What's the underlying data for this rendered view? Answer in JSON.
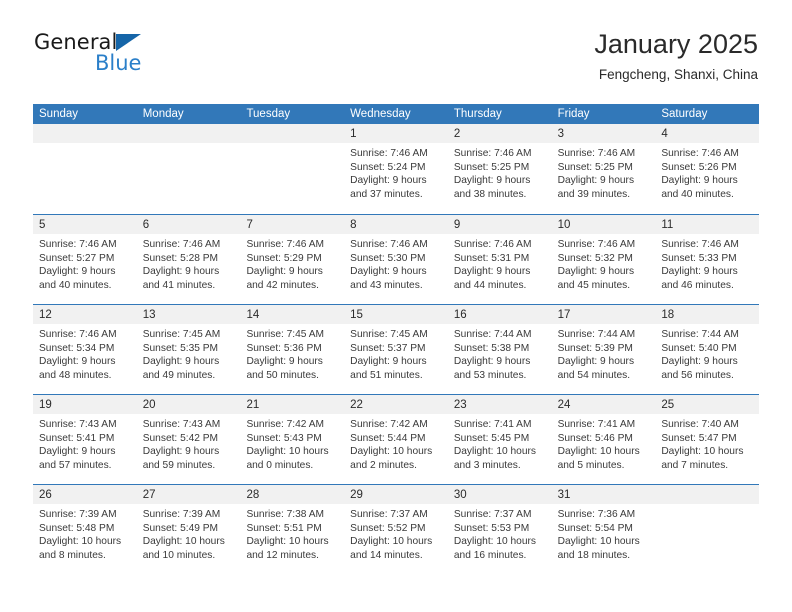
{
  "brand": {
    "name_part1": "General",
    "name_part2": "Blue",
    "triangle_icon": "triangle-icon",
    "accent_color": "#2a7fc9"
  },
  "header": {
    "title": "January 2025",
    "location": "Fengcheng, Shanxi, China"
  },
  "calendar": {
    "header_color": "#3278b9",
    "weekdays": [
      "Sunday",
      "Monday",
      "Tuesday",
      "Wednesday",
      "Thursday",
      "Friday",
      "Saturday"
    ],
    "weeks": [
      [
        {
          "day": "",
          "empty": true
        },
        {
          "day": "",
          "empty": true
        },
        {
          "day": "",
          "empty": true
        },
        {
          "day": "1",
          "sunrise": "Sunrise: 7:46 AM",
          "sunset": "Sunset: 5:24 PM",
          "daylight1": "Daylight: 9 hours",
          "daylight2": "and 37 minutes."
        },
        {
          "day": "2",
          "sunrise": "Sunrise: 7:46 AM",
          "sunset": "Sunset: 5:25 PM",
          "daylight1": "Daylight: 9 hours",
          "daylight2": "and 38 minutes."
        },
        {
          "day": "3",
          "sunrise": "Sunrise: 7:46 AM",
          "sunset": "Sunset: 5:25 PM",
          "daylight1": "Daylight: 9 hours",
          "daylight2": "and 39 minutes."
        },
        {
          "day": "4",
          "sunrise": "Sunrise: 7:46 AM",
          "sunset": "Sunset: 5:26 PM",
          "daylight1": "Daylight: 9 hours",
          "daylight2": "and 40 minutes."
        }
      ],
      [
        {
          "day": "5",
          "sunrise": "Sunrise: 7:46 AM",
          "sunset": "Sunset: 5:27 PM",
          "daylight1": "Daylight: 9 hours",
          "daylight2": "and 40 minutes."
        },
        {
          "day": "6",
          "sunrise": "Sunrise: 7:46 AM",
          "sunset": "Sunset: 5:28 PM",
          "daylight1": "Daylight: 9 hours",
          "daylight2": "and 41 minutes."
        },
        {
          "day": "7",
          "sunrise": "Sunrise: 7:46 AM",
          "sunset": "Sunset: 5:29 PM",
          "daylight1": "Daylight: 9 hours",
          "daylight2": "and 42 minutes."
        },
        {
          "day": "8",
          "sunrise": "Sunrise: 7:46 AM",
          "sunset": "Sunset: 5:30 PM",
          "daylight1": "Daylight: 9 hours",
          "daylight2": "and 43 minutes."
        },
        {
          "day": "9",
          "sunrise": "Sunrise: 7:46 AM",
          "sunset": "Sunset: 5:31 PM",
          "daylight1": "Daylight: 9 hours",
          "daylight2": "and 44 minutes."
        },
        {
          "day": "10",
          "sunrise": "Sunrise: 7:46 AM",
          "sunset": "Sunset: 5:32 PM",
          "daylight1": "Daylight: 9 hours",
          "daylight2": "and 45 minutes."
        },
        {
          "day": "11",
          "sunrise": "Sunrise: 7:46 AM",
          "sunset": "Sunset: 5:33 PM",
          "daylight1": "Daylight: 9 hours",
          "daylight2": "and 46 minutes."
        }
      ],
      [
        {
          "day": "12",
          "sunrise": "Sunrise: 7:46 AM",
          "sunset": "Sunset: 5:34 PM",
          "daylight1": "Daylight: 9 hours",
          "daylight2": "and 48 minutes."
        },
        {
          "day": "13",
          "sunrise": "Sunrise: 7:45 AM",
          "sunset": "Sunset: 5:35 PM",
          "daylight1": "Daylight: 9 hours",
          "daylight2": "and 49 minutes."
        },
        {
          "day": "14",
          "sunrise": "Sunrise: 7:45 AM",
          "sunset": "Sunset: 5:36 PM",
          "daylight1": "Daylight: 9 hours",
          "daylight2": "and 50 minutes."
        },
        {
          "day": "15",
          "sunrise": "Sunrise: 7:45 AM",
          "sunset": "Sunset: 5:37 PM",
          "daylight1": "Daylight: 9 hours",
          "daylight2": "and 51 minutes."
        },
        {
          "day": "16",
          "sunrise": "Sunrise: 7:44 AM",
          "sunset": "Sunset: 5:38 PM",
          "daylight1": "Daylight: 9 hours",
          "daylight2": "and 53 minutes."
        },
        {
          "day": "17",
          "sunrise": "Sunrise: 7:44 AM",
          "sunset": "Sunset: 5:39 PM",
          "daylight1": "Daylight: 9 hours",
          "daylight2": "and 54 minutes."
        },
        {
          "day": "18",
          "sunrise": "Sunrise: 7:44 AM",
          "sunset": "Sunset: 5:40 PM",
          "daylight1": "Daylight: 9 hours",
          "daylight2": "and 56 minutes."
        }
      ],
      [
        {
          "day": "19",
          "sunrise": "Sunrise: 7:43 AM",
          "sunset": "Sunset: 5:41 PM",
          "daylight1": "Daylight: 9 hours",
          "daylight2": "and 57 minutes."
        },
        {
          "day": "20",
          "sunrise": "Sunrise: 7:43 AM",
          "sunset": "Sunset: 5:42 PM",
          "daylight1": "Daylight: 9 hours",
          "daylight2": "and 59 minutes."
        },
        {
          "day": "21",
          "sunrise": "Sunrise: 7:42 AM",
          "sunset": "Sunset: 5:43 PM",
          "daylight1": "Daylight: 10 hours",
          "daylight2": "and 0 minutes."
        },
        {
          "day": "22",
          "sunrise": "Sunrise: 7:42 AM",
          "sunset": "Sunset: 5:44 PM",
          "daylight1": "Daylight: 10 hours",
          "daylight2": "and 2 minutes."
        },
        {
          "day": "23",
          "sunrise": "Sunrise: 7:41 AM",
          "sunset": "Sunset: 5:45 PM",
          "daylight1": "Daylight: 10 hours",
          "daylight2": "and 3 minutes."
        },
        {
          "day": "24",
          "sunrise": "Sunrise: 7:41 AM",
          "sunset": "Sunset: 5:46 PM",
          "daylight1": "Daylight: 10 hours",
          "daylight2": "and 5 minutes."
        },
        {
          "day": "25",
          "sunrise": "Sunrise: 7:40 AM",
          "sunset": "Sunset: 5:47 PM",
          "daylight1": "Daylight: 10 hours",
          "daylight2": "and 7 minutes."
        }
      ],
      [
        {
          "day": "26",
          "sunrise": "Sunrise: 7:39 AM",
          "sunset": "Sunset: 5:48 PM",
          "daylight1": "Daylight: 10 hours",
          "daylight2": "and 8 minutes."
        },
        {
          "day": "27",
          "sunrise": "Sunrise: 7:39 AM",
          "sunset": "Sunset: 5:49 PM",
          "daylight1": "Daylight: 10 hours",
          "daylight2": "and 10 minutes."
        },
        {
          "day": "28",
          "sunrise": "Sunrise: 7:38 AM",
          "sunset": "Sunset: 5:51 PM",
          "daylight1": "Daylight: 10 hours",
          "daylight2": "and 12 minutes."
        },
        {
          "day": "29",
          "sunrise": "Sunrise: 7:37 AM",
          "sunset": "Sunset: 5:52 PM",
          "daylight1": "Daylight: 10 hours",
          "daylight2": "and 14 minutes."
        },
        {
          "day": "30",
          "sunrise": "Sunrise: 7:37 AM",
          "sunset": "Sunset: 5:53 PM",
          "daylight1": "Daylight: 10 hours",
          "daylight2": "and 16 minutes."
        },
        {
          "day": "31",
          "sunrise": "Sunrise: 7:36 AM",
          "sunset": "Sunset: 5:54 PM",
          "daylight1": "Daylight: 10 hours",
          "daylight2": "and 18 minutes."
        },
        {
          "day": "",
          "empty": true
        }
      ]
    ]
  }
}
